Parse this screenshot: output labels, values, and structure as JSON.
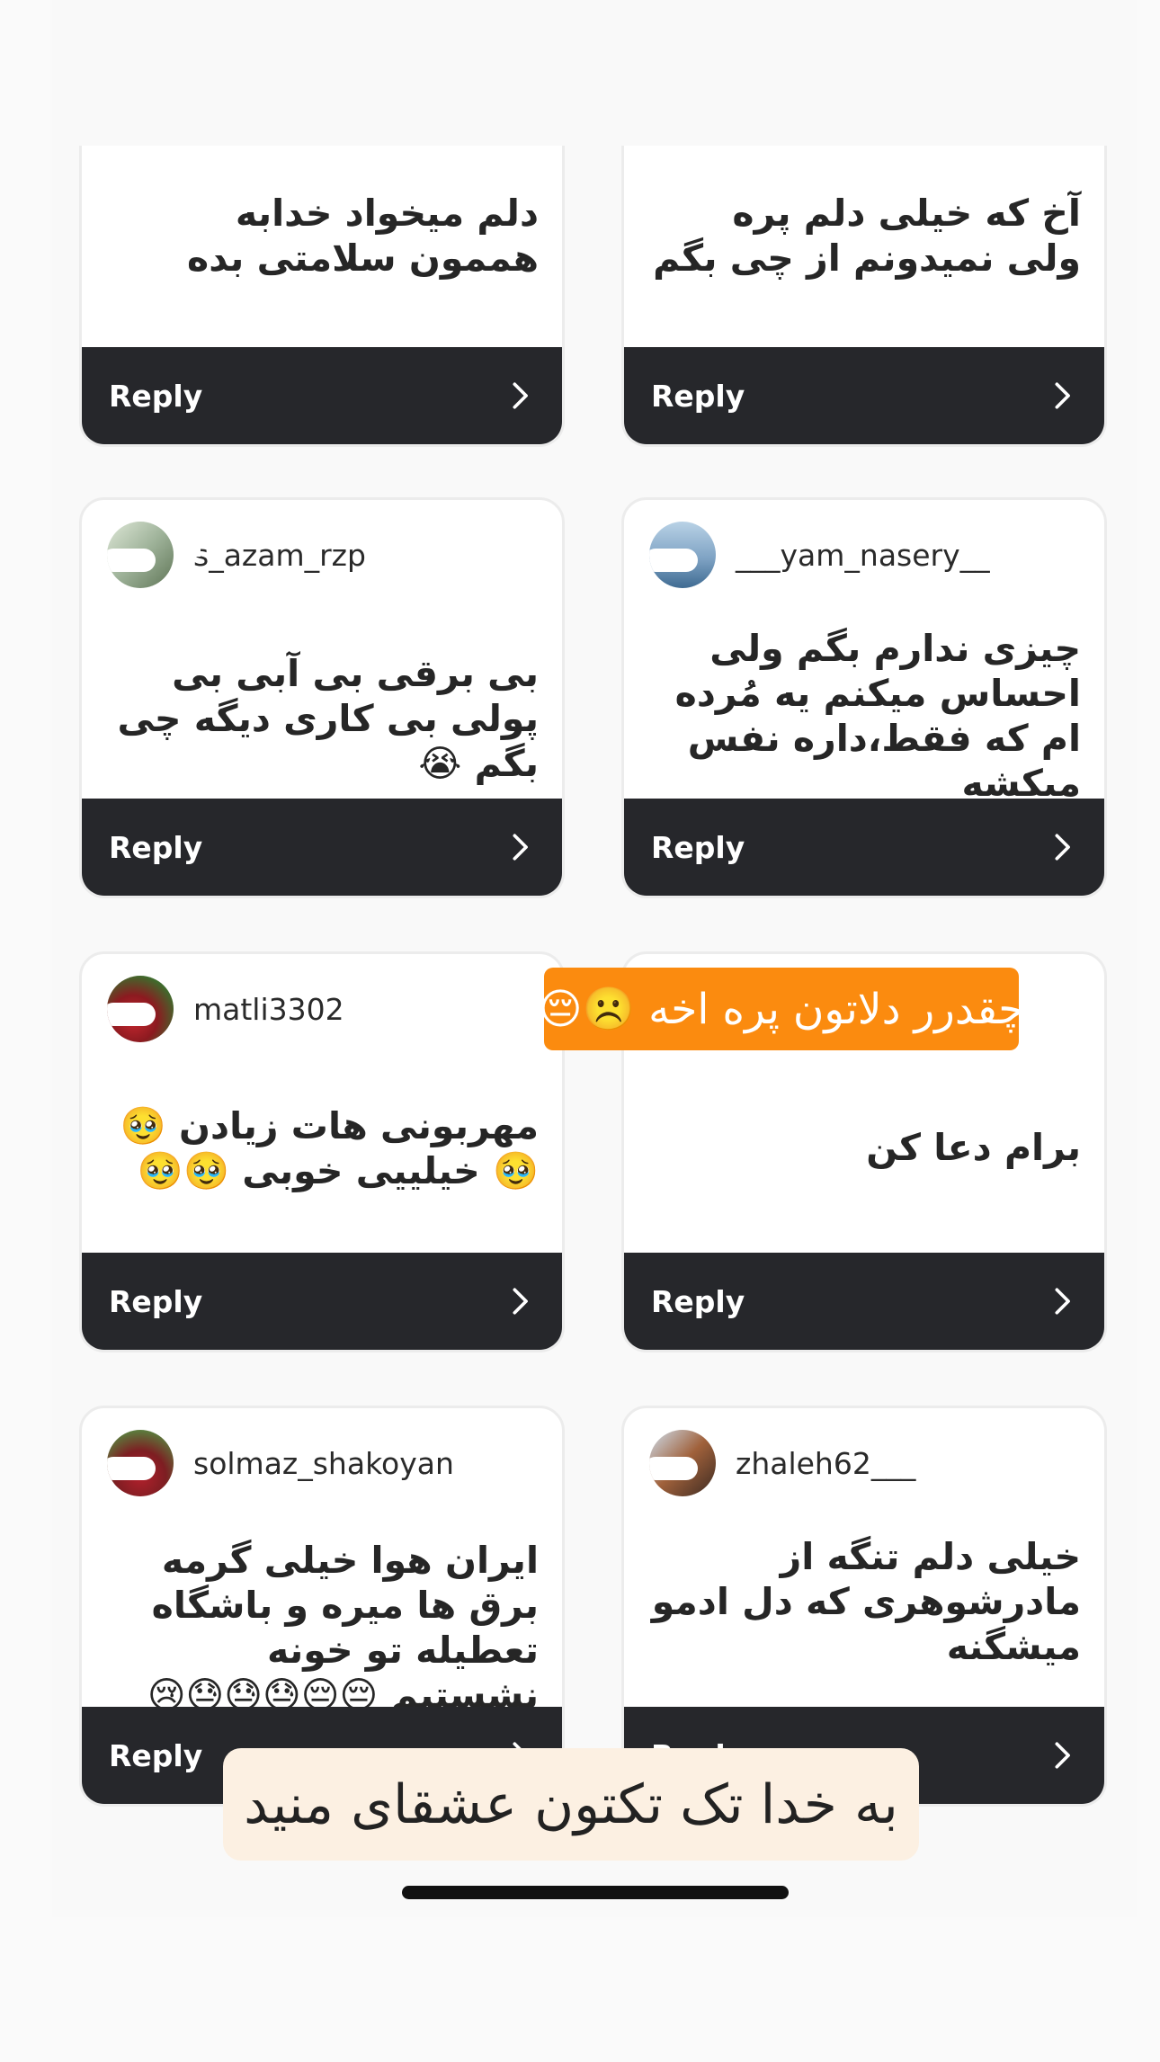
{
  "reply_label": "Reply",
  "cards": [
    {
      "username": "",
      "message": "دلم میخواد خدابه هممون سلامتی بده"
    },
    {
      "username": "",
      "message": "آخ که خیلی دلم پره ولی نمیدونم از چی بگم"
    },
    {
      "username": "s_azam_rzp",
      "message": "بی برقی بی آبی بی پولی بی کاری دیگه چی بگم 😭"
    },
    {
      "username": "___yam_nasery__",
      "message": "چیزی ندارم بگم ولی احساس میکنم یه مُرده ام که فقط،داره نفس میکشه"
    },
    {
      "username": "matli3302",
      "message": "مهربونی هات زیادن 🥹🥹 خیلییی خوبی 🥹🥹"
    },
    {
      "username": "",
      "message": "برام  دعا کن"
    },
    {
      "username": "solmaz_shakoyan",
      "message": "ایران هوا خیلی گرمه برق ها میره و باشگاه تعطیله تو خونه نشستیم 😔😔😓😓😓😢"
    },
    {
      "username": "zhaleh62___",
      "message": "خیلی دلم تنگه از مادرشوهری که دل ادمو میشگنه"
    }
  ],
  "stickers": {
    "top": "چقدرر دلاتون پره اخه ☹️😔",
    "bottom": "به خدا تک تکتون عشقای منید"
  },
  "icons": {
    "reply_chevron": "chevron-right-icon",
    "avatar": "user-avatar"
  },
  "colors": {
    "reply_bar": "#26272b",
    "sticker_orange": "#fb8b0f",
    "sticker_cream": "#fcf0e2"
  }
}
